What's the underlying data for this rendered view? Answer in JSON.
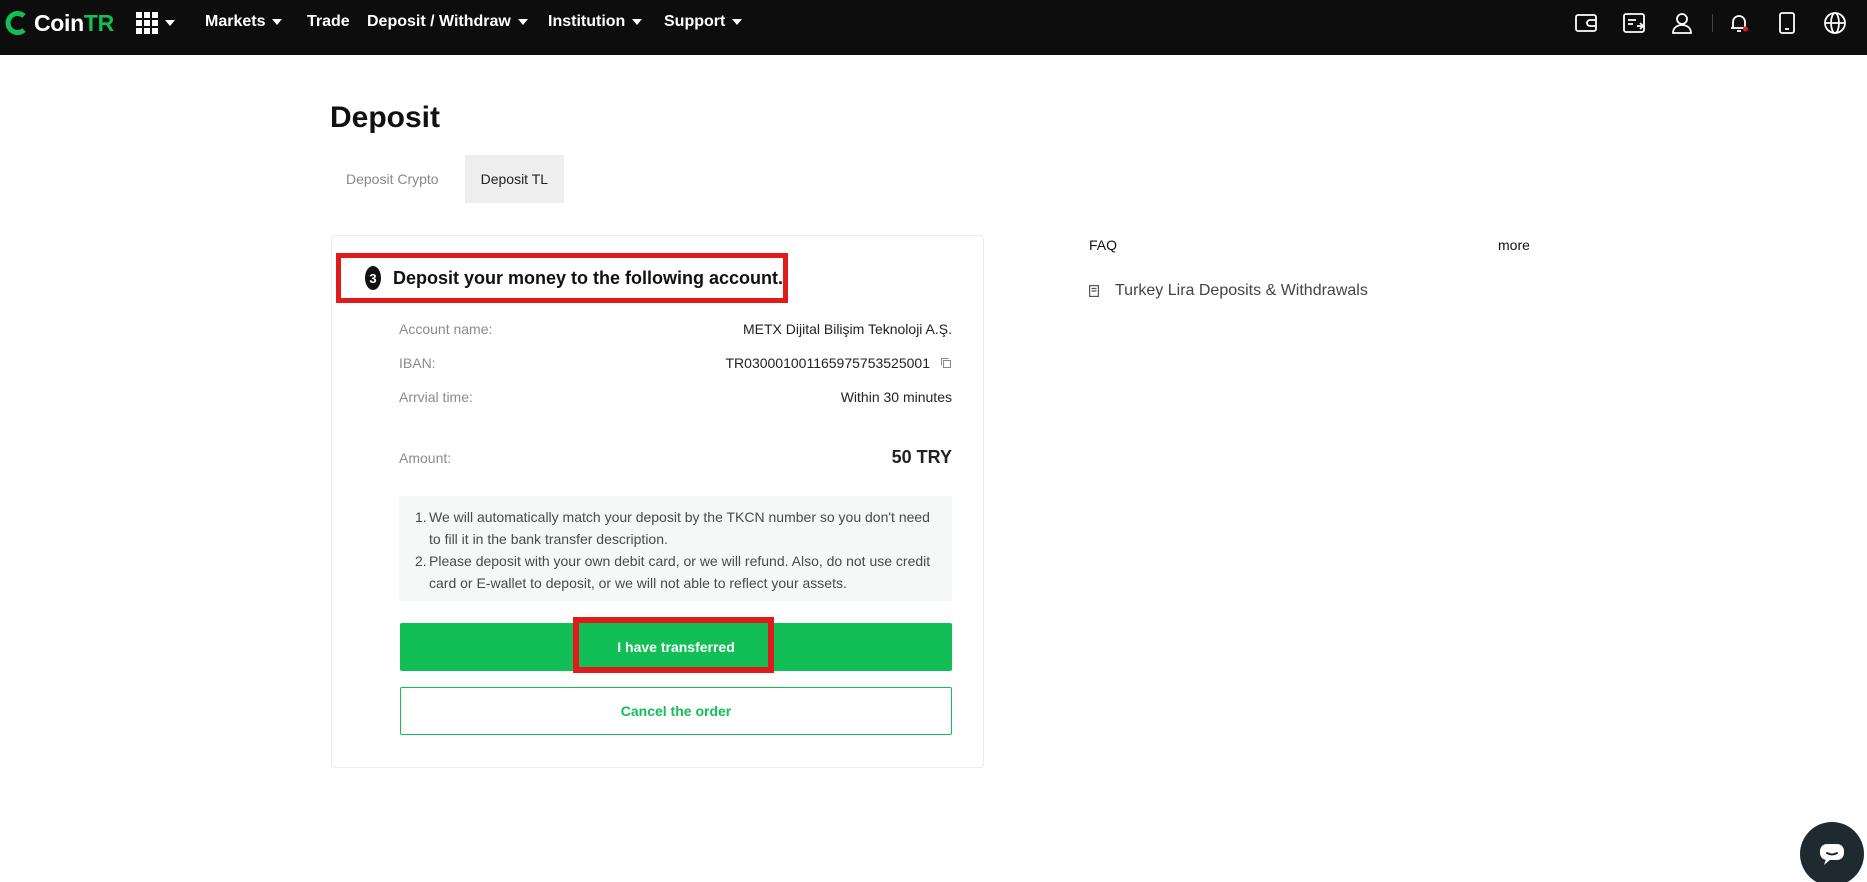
{
  "nav": {
    "brand_coin": "Coin",
    "brand_tr": "TR",
    "items": [
      {
        "label": "Markets",
        "has_caret": true
      },
      {
        "label": "Trade",
        "has_caret": false
      },
      {
        "label": "Deposit / Withdraw",
        "has_caret": true
      },
      {
        "label": "Institution",
        "has_caret": true
      },
      {
        "label": "Support",
        "has_caret": true
      }
    ],
    "right_icons": [
      "wallet-icon",
      "orders-icon",
      "user-icon",
      "bell-icon",
      "mobile-icon",
      "globe-icon"
    ]
  },
  "page": {
    "title": "Deposit",
    "tabs": [
      {
        "label": "Deposit Crypto",
        "active": false
      },
      {
        "label": "Deposit TL",
        "active": true
      }
    ]
  },
  "deposit": {
    "step_number": "3",
    "step_text": "Deposit your money to the following account.",
    "account_name_label": "Account name:",
    "account_name_value": "METX Dijital Bilişim Teknoloji A.Ş.",
    "iban_label": "IBAN:",
    "iban_value": "TR030001001165975753525001",
    "arrival_label": "Arrvial time:",
    "arrival_value": "Within 30 minutes",
    "amount_label": "Amount:",
    "amount_value": "50 TRY",
    "notes": [
      {
        "num": "1.",
        "text": "We will automatically match your deposit by the TKCN number so you don't need to fill it in the bank transfer description."
      },
      {
        "num": "2.",
        "text": "Please deposit with your own debit card, or we will refund. Also, do not use credit card or E-wallet to deposit, or we will not able to reflect your assets."
      }
    ],
    "confirm_button": "I have transferred",
    "cancel_button": "Cancel the order"
  },
  "faq": {
    "title": "FAQ",
    "more": "more",
    "items": [
      {
        "label": "Turkey Lira Deposits & Withdrawals"
      }
    ]
  },
  "colors": {
    "brand_green": "#11bf56",
    "nav_bg": "#0d0d0d",
    "highlight_red": "#e01b1b"
  }
}
